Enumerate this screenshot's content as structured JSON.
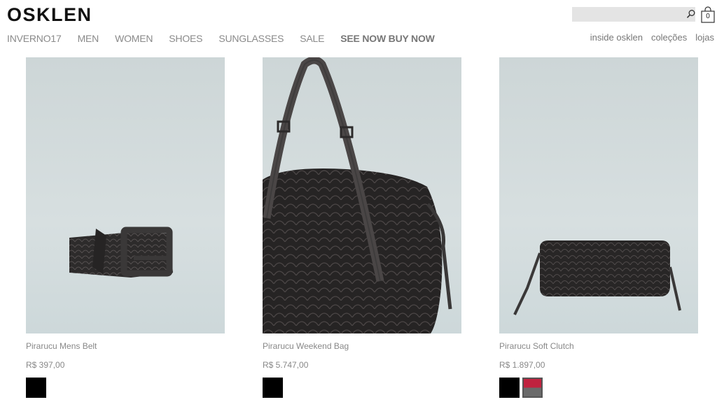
{
  "brand": {
    "logo": "OSKLEN"
  },
  "header": {
    "search": {
      "placeholder": ""
    },
    "cart": {
      "count": "0"
    }
  },
  "nav": {
    "items": [
      "INVERNO17",
      "MEN",
      "WOMEN",
      "SHOES",
      "SUNGLASSES",
      "SALE",
      "SEE NOW BUY NOW"
    ]
  },
  "subnav": {
    "items": [
      "inside osklen",
      "coleções",
      "lojas"
    ]
  },
  "products": [
    {
      "name": "Pirarucu Mens Belt",
      "price": "R$ 397,00",
      "swatches": [
        "#000000"
      ]
    },
    {
      "name": "Pirarucu Weekend Bag",
      "price": "R$ 5.747,00",
      "swatches": [
        "#000000"
      ]
    },
    {
      "name": "Pirarucu Soft Clutch",
      "price": "R$ 1.897,00",
      "swatches": [
        "#000000",
        "#c0223f"
      ]
    }
  ]
}
